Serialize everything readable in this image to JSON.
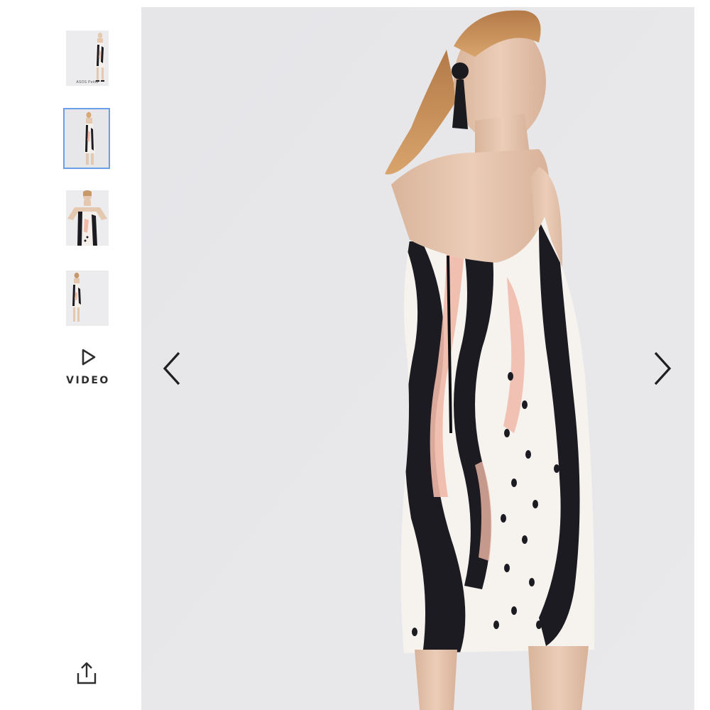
{
  "gallery": {
    "thumbnails": [
      {
        "caption": "ASOS Petite",
        "selected": false
      },
      {
        "caption": "",
        "selected": true
      },
      {
        "caption": "",
        "selected": false
      },
      {
        "caption": "",
        "selected": false
      }
    ],
    "video_label": "VIDEO",
    "selected_index": 1
  },
  "colors": {
    "thumb_border": "#6aa0e8",
    "photo_background": "#e8e8ea",
    "icon": "#2d2d2d",
    "dress_black": "#1c1b22",
    "dress_pink": "#f0b9a8",
    "dress_white": "#f6f2ee"
  },
  "icons": {
    "play": "play-icon",
    "share": "share-icon",
    "prev": "chevron-left-icon",
    "next": "chevron-right-icon"
  }
}
